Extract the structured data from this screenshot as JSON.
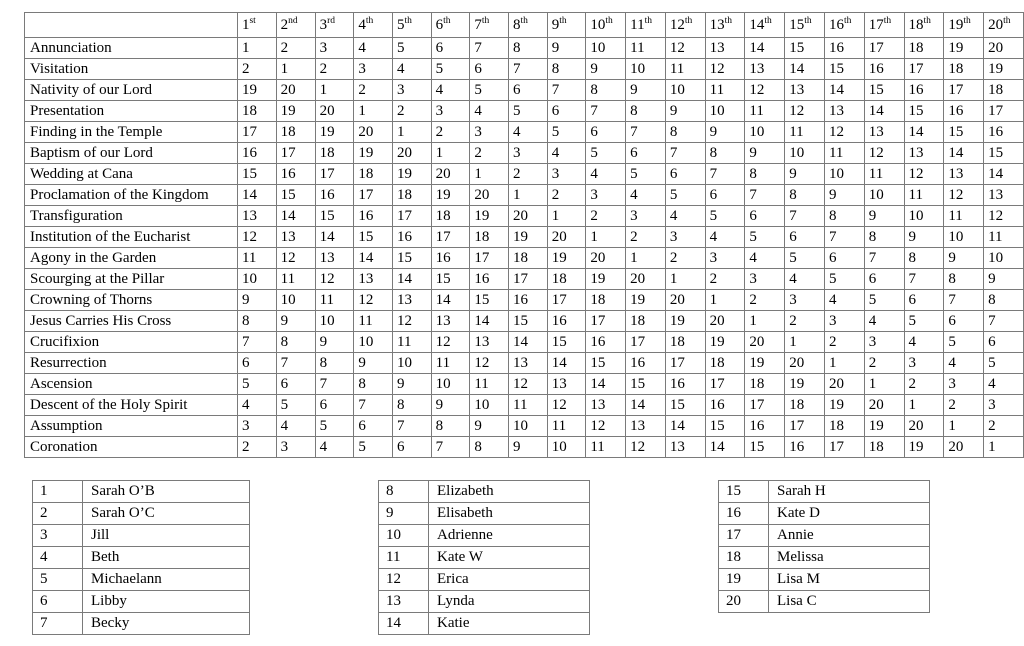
{
  "main_table": {
    "corner_label": "",
    "column_headers": [
      {
        "value": "1",
        "suffix": "st"
      },
      {
        "value": "2",
        "suffix": "nd"
      },
      {
        "value": "3",
        "suffix": "rd"
      },
      {
        "value": "4",
        "suffix": "th"
      },
      {
        "value": "5",
        "suffix": "th"
      },
      {
        "value": "6",
        "suffix": "th"
      },
      {
        "value": "7",
        "suffix": "th"
      },
      {
        "value": "8",
        "suffix": "th"
      },
      {
        "value": "9",
        "suffix": "th"
      },
      {
        "value": "10",
        "suffix": "th"
      },
      {
        "value": "11",
        "suffix": "th"
      },
      {
        "value": "12",
        "suffix": "th"
      },
      {
        "value": "13",
        "suffix": "th"
      },
      {
        "value": "14",
        "suffix": "th"
      },
      {
        "value": "15",
        "suffix": "th"
      },
      {
        "value": "16",
        "suffix": "th"
      },
      {
        "value": "17",
        "suffix": "th"
      },
      {
        "value": "18",
        "suffix": "th"
      },
      {
        "value": "19",
        "suffix": "th"
      },
      {
        "value": "20",
        "suffix": "th"
      }
    ],
    "rows": [
      {
        "label": "Annunciation",
        "values": [
          1,
          2,
          3,
          4,
          5,
          6,
          7,
          8,
          9,
          10,
          11,
          12,
          13,
          14,
          15,
          16,
          17,
          18,
          19,
          20
        ]
      },
      {
        "label": "Visitation",
        "values": [
          2,
          1,
          2,
          3,
          4,
          5,
          6,
          7,
          8,
          9,
          10,
          11,
          12,
          13,
          14,
          15,
          16,
          17,
          18,
          19
        ]
      },
      {
        "label": "Nativity of our Lord",
        "values": [
          19,
          20,
          1,
          2,
          3,
          4,
          5,
          6,
          7,
          8,
          9,
          10,
          11,
          12,
          13,
          14,
          15,
          16,
          17,
          18
        ]
      },
      {
        "label": "Presentation",
        "values": [
          18,
          19,
          20,
          1,
          2,
          3,
          4,
          5,
          6,
          7,
          8,
          9,
          10,
          11,
          12,
          13,
          14,
          15,
          16,
          17
        ]
      },
      {
        "label": "Finding in the Temple",
        "values": [
          17,
          18,
          19,
          20,
          1,
          2,
          3,
          4,
          5,
          6,
          7,
          8,
          9,
          10,
          11,
          12,
          13,
          14,
          15,
          16
        ]
      },
      {
        "label": "Baptism of our Lord",
        "values": [
          16,
          17,
          18,
          19,
          20,
          1,
          2,
          3,
          4,
          5,
          6,
          7,
          8,
          9,
          10,
          11,
          12,
          13,
          14,
          15
        ]
      },
      {
        "label": "Wedding at Cana",
        "values": [
          15,
          16,
          17,
          18,
          19,
          20,
          1,
          2,
          3,
          4,
          5,
          6,
          7,
          8,
          9,
          10,
          11,
          12,
          13,
          14
        ]
      },
      {
        "label": "Proclamation of the Kingdom",
        "values": [
          14,
          15,
          16,
          17,
          18,
          19,
          20,
          1,
          2,
          3,
          4,
          5,
          6,
          7,
          8,
          9,
          10,
          11,
          12,
          13
        ]
      },
      {
        "label": "Transfiguration",
        "values": [
          13,
          14,
          15,
          16,
          17,
          18,
          19,
          20,
          1,
          2,
          3,
          4,
          5,
          6,
          7,
          8,
          9,
          10,
          11,
          12
        ]
      },
      {
        "label": "Institution of the Eucharist",
        "values": [
          12,
          13,
          14,
          15,
          16,
          17,
          18,
          19,
          20,
          1,
          2,
          3,
          4,
          5,
          6,
          7,
          8,
          9,
          10,
          11
        ]
      },
      {
        "label": "Agony in the Garden",
        "values": [
          11,
          12,
          13,
          14,
          15,
          16,
          17,
          18,
          19,
          20,
          1,
          2,
          3,
          4,
          5,
          6,
          7,
          8,
          9,
          10
        ]
      },
      {
        "label": "Scourging at the Pillar",
        "values": [
          10,
          11,
          12,
          13,
          14,
          15,
          16,
          17,
          18,
          19,
          20,
          1,
          2,
          3,
          4,
          5,
          6,
          7,
          8,
          9
        ]
      },
      {
        "label": "Crowning of Thorns",
        "values": [
          9,
          10,
          11,
          12,
          13,
          14,
          15,
          16,
          17,
          18,
          19,
          20,
          1,
          2,
          3,
          4,
          5,
          6,
          7,
          8
        ]
      },
      {
        "label": "Jesus Carries His Cross",
        "values": [
          8,
          9,
          10,
          11,
          12,
          13,
          14,
          15,
          16,
          17,
          18,
          19,
          20,
          1,
          2,
          3,
          4,
          5,
          6,
          7
        ]
      },
      {
        "label": "Crucifixion",
        "values": [
          7,
          8,
          9,
          10,
          11,
          12,
          13,
          14,
          15,
          16,
          17,
          18,
          19,
          20,
          1,
          2,
          3,
          4,
          5,
          6
        ]
      },
      {
        "label": "Resurrection",
        "values": [
          6,
          7,
          8,
          9,
          10,
          11,
          12,
          13,
          14,
          15,
          16,
          17,
          18,
          19,
          20,
          1,
          2,
          3,
          4,
          5
        ]
      },
      {
        "label": "Ascension",
        "values": [
          5,
          6,
          7,
          8,
          9,
          10,
          11,
          12,
          13,
          14,
          15,
          16,
          17,
          18,
          19,
          20,
          1,
          2,
          3,
          4
        ]
      },
      {
        "label": "Descent of the Holy Spirit",
        "values": [
          4,
          5,
          6,
          7,
          8,
          9,
          10,
          11,
          12,
          13,
          14,
          15,
          16,
          17,
          18,
          19,
          20,
          1,
          2,
          3
        ]
      },
      {
        "label": "Assumption",
        "values": [
          3,
          4,
          5,
          6,
          7,
          8,
          9,
          10,
          11,
          12,
          13,
          14,
          15,
          16,
          17,
          18,
          19,
          20,
          1,
          2
        ]
      },
      {
        "label": "Coronation",
        "values": [
          2,
          3,
          4,
          5,
          6,
          7,
          8,
          9,
          10,
          11,
          12,
          13,
          14,
          15,
          16,
          17,
          18,
          19,
          20,
          1
        ]
      }
    ]
  },
  "legends": [
    {
      "entries": [
        {
          "number": "1",
          "name": "Sarah O’B"
        },
        {
          "number": "2",
          "name": "Sarah O’C"
        },
        {
          "number": "3",
          "name": "Jill"
        },
        {
          "number": "4",
          "name": "Beth"
        },
        {
          "number": "5",
          "name": "Michaelann"
        },
        {
          "number": "6",
          "name": "Libby"
        },
        {
          "number": "7",
          "name": "Becky"
        }
      ]
    },
    {
      "entries": [
        {
          "number": "8",
          "name": "Elizabeth"
        },
        {
          "number": "9",
          "name": "Elisabeth"
        },
        {
          "number": "10",
          "name": "Adrienne"
        },
        {
          "number": "11",
          "name": "Kate W"
        },
        {
          "number": "12",
          "name": "Erica"
        },
        {
          "number": "13",
          "name": "Lynda"
        },
        {
          "number": "14",
          "name": "Katie"
        }
      ]
    },
    {
      "entries": [
        {
          "number": "15",
          "name": "Sarah H"
        },
        {
          "number": "16",
          "name": "Kate D"
        },
        {
          "number": "17",
          "name": "Annie"
        },
        {
          "number": "18",
          "name": "Melissa"
        },
        {
          "number": "19",
          "name": "Lisa M"
        },
        {
          "number": "20",
          "name": "Lisa C"
        }
      ]
    }
  ]
}
